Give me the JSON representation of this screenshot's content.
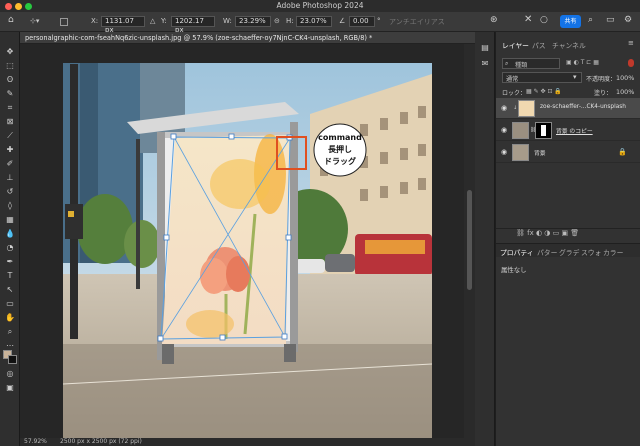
{
  "window": {
    "title": "Adobe Photoshop 2024"
  },
  "options_bar": {
    "x_label": "X:",
    "x_value": "1131.07 px",
    "y_label": "Y:",
    "y_value": "1202.17 px",
    "w_label": "W:",
    "w_value": "23.29%",
    "h_label": "H:",
    "h_value": "23.07%",
    "angle_label": "∠",
    "angle_value": "0.00",
    "angle_unit": "°",
    "antialias_label": "アンチエイリアス",
    "share_label": "共有"
  },
  "document_tab": {
    "title": "personalgraphic-com-fseahNq6zic-unsplash.jpg @ 57.9% (zoe-schaeffer-oy7NjnC-CK4-unsplash, RGB/8) *"
  },
  "callout": {
    "line1": "command",
    "line2": "長押し",
    "line3": "ドラッグ"
  },
  "status_bar": {
    "zoom": "57.92%",
    "doc_size": "2500 px x 2500 px (72 ppi)"
  },
  "layers_panel": {
    "tabs": [
      "レイヤー",
      "パス",
      "チャンネル"
    ],
    "kind_label": "種類",
    "blend_mode": "通常",
    "opacity_label": "不透明度：",
    "opacity_value": "100%",
    "lock_label": "ロック：",
    "fill_label": "塗り：",
    "fill_value": "100%",
    "layers": [
      {
        "name": "zoe-schaeffer-...CK4-unsplash"
      },
      {
        "name": "背景 のコピー"
      },
      {
        "name": "背景"
      }
    ]
  },
  "properties_panel": {
    "tabs": [
      "プロパティ",
      "パター",
      "グラデ",
      "スウォ",
      "カラー"
    ],
    "empty_text": "属性なし"
  },
  "colors": {
    "accent": "#1473e6",
    "callout_border": "#e05020"
  }
}
